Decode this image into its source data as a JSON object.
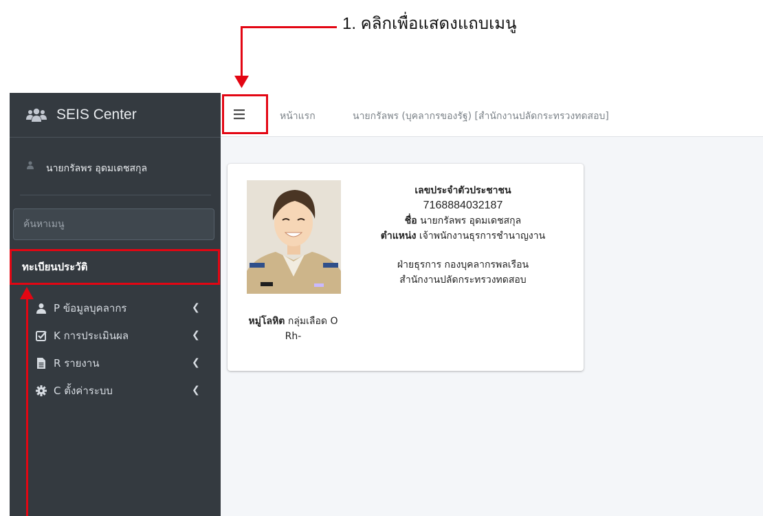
{
  "annotation": {
    "text": "1. คลิกเพื่อแสดงแถบเมนู"
  },
  "sidebar": {
    "brand": "SEIS Center",
    "user_name": "นายกรัลพร อุดมเดชสกุล",
    "search_placeholder": "ค้นหาเมนู",
    "history_label": "ทะเบียนประวัติ",
    "items": [
      {
        "label": "P ข้อมูลบุคลากร",
        "icon": "user-icon"
      },
      {
        "label": "K การประเมินผล",
        "icon": "check-square-icon"
      },
      {
        "label": "R รายงาน",
        "icon": "file-icon"
      },
      {
        "label": "C ตั้งค่าระบบ",
        "icon": "gear-icon"
      }
    ]
  },
  "topbar": {
    "home": "หน้าแรก",
    "user": "นายกรัลพร (บุคลากรของรัฐ) [สำนักงานปลัดกระทรวงทดสอบ]"
  },
  "profile": {
    "id_label": "เลขประจำตัวประชาชน",
    "id_value": "7168884032187",
    "name_label": "ชื่อ",
    "name_value": "นายกรัลพร อุดมเดชสกุล",
    "position_label": "ตำแหน่ง",
    "position_value": "เจ้าพนักงานธุรการชำนาญงาน",
    "department": "ฝ่ายธุรการ กองบุคลากรพลเรือน",
    "office": "สำนักงานปลัดกระทรวงทดสอบ",
    "blood_label": "หมู่โลหิต",
    "blood_value": "กลุ่มเลือด O Rh-"
  },
  "colors": {
    "annotation_red": "#e30613",
    "sidebar_bg": "#343a40",
    "content_bg": "#f4f6f9"
  }
}
